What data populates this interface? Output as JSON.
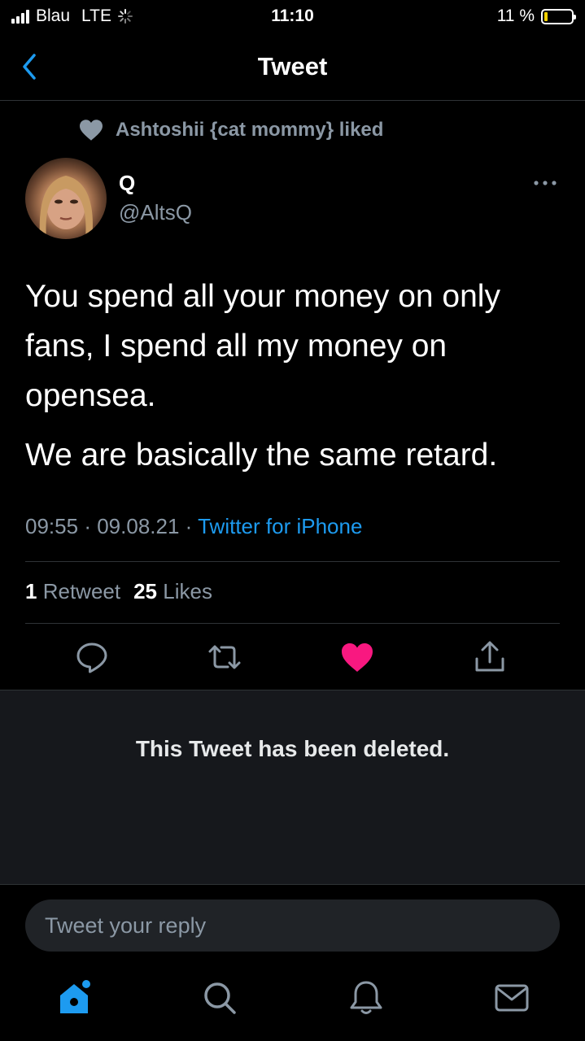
{
  "status_bar": {
    "carrier": "Blau",
    "network": "LTE",
    "time": "11:10",
    "battery_percent": "11 %",
    "battery_level": 0.11
  },
  "header": {
    "title": "Tweet"
  },
  "social_context": {
    "text": "Ashtoshii {cat mommy} liked"
  },
  "tweet": {
    "author_name": "Q",
    "author_handle": "@AltsQ",
    "text_paragraphs": [
      "You spend all your money on only fans, I spend all my money on opensea.",
      "We are basically the same retard."
    ],
    "time": "09:55",
    "date": "09.08.21",
    "source": "Twitter for iPhone",
    "separator": "·",
    "retweet_count": "1",
    "retweet_label": "Retweet",
    "like_count": "25",
    "like_label": "Likes",
    "liked": true
  },
  "deleted_notice": "This Tweet has been deleted.",
  "reply": {
    "placeholder": "Tweet your reply"
  },
  "colors": {
    "accent": "#1d9bf0",
    "like": "#f91880",
    "secondary_text": "#8b98a5",
    "background": "#000000"
  },
  "tabs": [
    "home-icon",
    "search-icon",
    "notifications-icon",
    "messages-icon"
  ]
}
